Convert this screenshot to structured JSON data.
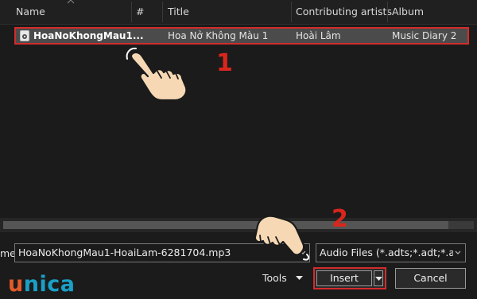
{
  "columns": {
    "name": "Name",
    "number": "#",
    "title": "Title",
    "artists": "Contributing artists",
    "album": "Album"
  },
  "file_row": {
    "name": "HoaNoKhongMau1...",
    "title": "Hoa Nở Không Màu 1",
    "artist": "Hoài Lâm",
    "album": "Music Diary 2"
  },
  "filename": {
    "label": "me:",
    "value": "HoaNoKhongMau1-HoaiLam-6281704.mp3"
  },
  "file_type": {
    "selected": "Audio Files (*.adts;*.adt;*.aac;*.a"
  },
  "buttons": {
    "tools": "Tools",
    "insert": "Insert",
    "cancel": "Cancel"
  },
  "annotations": {
    "step1": "1",
    "step2": "2"
  },
  "logo": {
    "text": "unica",
    "first_letter": "u",
    "rest": "nica"
  },
  "colors": {
    "highlight_border": "#d42b2b",
    "step_number": "#d9261c",
    "logo_u": "#e05a2a",
    "logo_rest": "#1aa0c8",
    "selected_row": "#4b4b4b"
  },
  "icons": {
    "file": "audio-file-icon",
    "hand": "pointing-hand-icon"
  }
}
